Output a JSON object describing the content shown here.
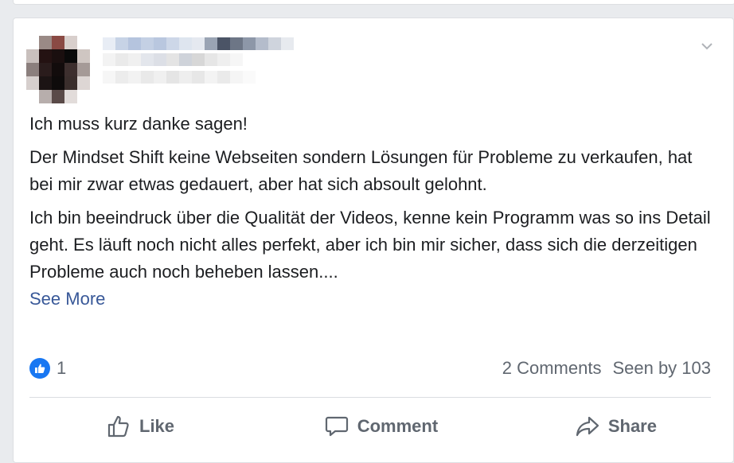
{
  "post": {
    "paragraphs": [
      "Ich muss kurz danke sagen!",
      "Der Mindset Shift keine Webseiten sondern Lösungen für Probleme zu verkaufen, hat bei mir zwar etwas gedauert, aber hat sich absoult gelohnt.",
      "Ich bin beeindruck über die Qualität der Videos, kenne kein Programm was so ins Detail geht. Es läuft noch nicht alles perfekt, aber ich bin mir sicher, dass sich die derzeitigen Probleme auch noch beheben lassen...."
    ],
    "see_more": "See More"
  },
  "stats": {
    "like_count": "1",
    "comments": "2 Comments",
    "seen_by": "Seen by 103"
  },
  "actions": {
    "like": "Like",
    "comment": "Comment",
    "share": "Share"
  },
  "colors": {
    "link": "#385898",
    "like_badge": "#1877f2",
    "muted_text": "#606770"
  },
  "icons": {
    "options": "chevron-down-icon",
    "like_badge": "thumbs-up-icon",
    "like": "thumbs-up-outline-icon",
    "comment": "speech-bubble-icon",
    "share": "share-arrow-icon"
  }
}
